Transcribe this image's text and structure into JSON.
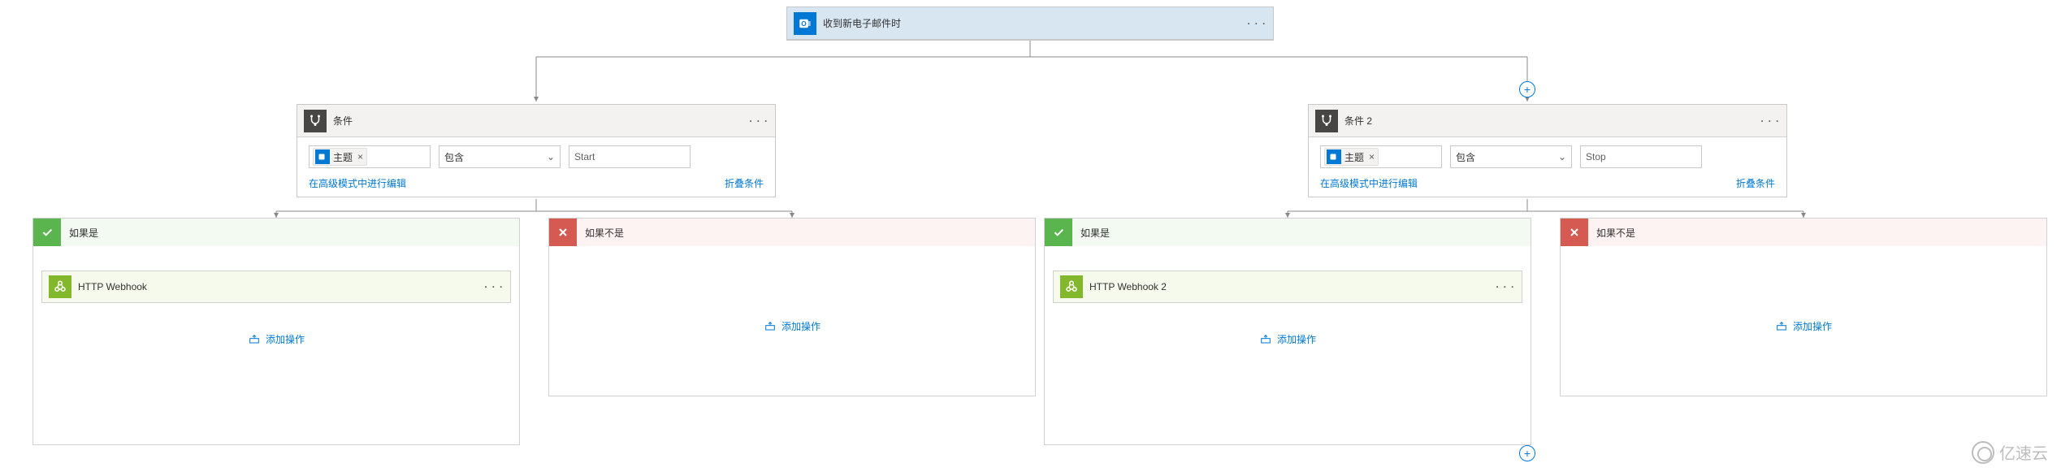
{
  "trigger": {
    "title": "收到新电子邮件时",
    "ellipsis": "· · ·",
    "icon_name": "outlook-icon"
  },
  "condition_left": {
    "title": "条件",
    "ellipsis": "· · ·",
    "token": {
      "label": "主题",
      "remove": "×",
      "icon_name": "outlook-icon"
    },
    "operator": "包含",
    "value": "Start",
    "advanced_link": "在高级模式中进行编辑",
    "collapse_link": "折叠条件"
  },
  "condition_right": {
    "title": "条件 2",
    "ellipsis": "· · ·",
    "token": {
      "label": "主题",
      "remove": "×",
      "icon_name": "outlook-icon"
    },
    "operator": "包含",
    "value": "Stop",
    "advanced_link": "在高级模式中进行编辑",
    "collapse_link": "折叠条件"
  },
  "branches": {
    "yes_label": "如果是",
    "no_label": "如果不是",
    "left_yes_action": {
      "title": "HTTP Webhook",
      "ellipsis": "· · ·"
    },
    "right_yes_action": {
      "title": "HTTP Webhook 2",
      "ellipsis": "· · ·"
    },
    "add_action_label": "添加操作"
  },
  "watermark": {
    "text": "亿速云"
  }
}
